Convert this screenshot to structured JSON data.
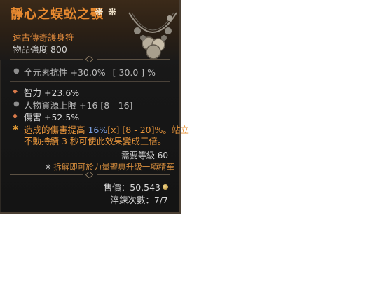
{
  "item": {
    "name": "靜心之蜈蚣之顎",
    "type": "遠古傳奇護身符",
    "power": "物品強度 800",
    "stars": [
      "❋",
      "❋"
    ]
  },
  "implicit": {
    "label": "全元素抗性 +30.0%",
    "range": "[ 30.0 ] %"
  },
  "affixes": [
    {
      "bullet": "diamond",
      "text": "智力 +23.6%"
    },
    {
      "bullet": "dot",
      "text": "人物資源上限 +16 [8 - 16]"
    },
    {
      "bullet": "diamond",
      "text": "傷害 +52.5%"
    }
  ],
  "aspect": {
    "part1": "造成的傷害提高 ",
    "value": "16%",
    "part2": "[x] [8 - 20]%。站立",
    "line2": "不動持續 3 秒可使此效果變成三倍。"
  },
  "requirement": "需要等級 60",
  "salvage": "拆解即可於力量聖典升級一項精華",
  "salvage_icon": "※",
  "price": "售價：50,543",
  "temper": "淬鍊次數：7/7",
  "colors": {
    "title": "#e88a30",
    "subtitle": "#e08a3c",
    "aspect": "#e8953b",
    "aspect_value": "#7ea4e6"
  }
}
